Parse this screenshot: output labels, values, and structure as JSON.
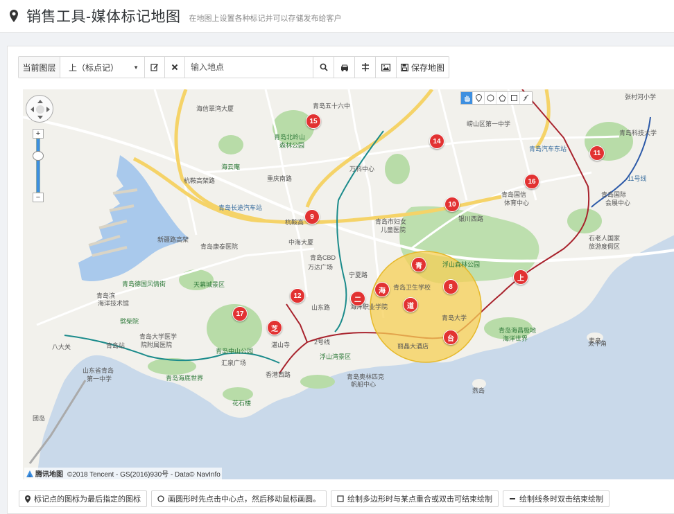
{
  "header": {
    "title": "销售工具-媒体标记地图",
    "subtitle": "在地图上设置各种标记并可以存储发布给客户"
  },
  "toolbar": {
    "layer_label": "当前图层",
    "layer_value": "上（标点记）",
    "location_placeholder": "输入地点",
    "save_label": "保存地图"
  },
  "map": {
    "copyright": "©2018 Tencent - GS(2016)930号 - Data© NavInfo",
    "provider_label": "腾讯地图",
    "markers": [
      {
        "label": "15"
      },
      {
        "label": "14"
      },
      {
        "label": "11"
      },
      {
        "label": "16"
      },
      {
        "label": "10"
      },
      {
        "label": "9"
      },
      {
        "label": "青"
      },
      {
        "label": "海"
      },
      {
        "label": "8"
      },
      {
        "label": "上"
      },
      {
        "label": "二"
      },
      {
        "label": "12"
      },
      {
        "label": "道"
      },
      {
        "label": "17"
      },
      {
        "label": "芝"
      },
      {
        "label": "台"
      }
    ],
    "pois": [
      {
        "name": "海信翠湾大厦"
      },
      {
        "name": "青岛五十六中"
      },
      {
        "name": "青岛北岭山"
      },
      {
        "name": "森林公园"
      },
      {
        "name": "海云庵"
      },
      {
        "name": "万科中心"
      },
      {
        "name": "崂山区第一中学"
      },
      {
        "name": "青岛汽车东站"
      },
      {
        "name": "张村河小学"
      },
      {
        "name": "青岛科技大学"
      },
      {
        "name": "重庆南路"
      },
      {
        "name": "杭鞍高架路"
      },
      {
        "name": "青岛长途汽车站"
      },
      {
        "name": "杭鞍高"
      },
      {
        "name": "青岛市妇女"
      },
      {
        "name": "儿童医院"
      },
      {
        "name": "青岛国信"
      },
      {
        "name": "体育中心"
      },
      {
        "name": "青岛国际"
      },
      {
        "name": "会展中心"
      },
      {
        "name": "银川西路"
      },
      {
        "name": "新疆路高架"
      },
      {
        "name": "青岛康泰医院"
      },
      {
        "name": "中海大厦"
      },
      {
        "name": "青岛CBD"
      },
      {
        "name": "万达广场"
      },
      {
        "name": "石老人国家"
      },
      {
        "name": "旅游度假区"
      },
      {
        "name": "浮山森林公园"
      },
      {
        "name": "宁夏路"
      },
      {
        "name": "青岛德国风情街"
      },
      {
        "name": "天幕城景区"
      },
      {
        "name": "青岛卫生学校"
      },
      {
        "name": "海洋职业学院"
      },
      {
        "name": "青岛滨"
      },
      {
        "name": "海洋技术馆"
      },
      {
        "name": "山东路"
      },
      {
        "name": "青岛大学"
      },
      {
        "name": "劈柴院"
      },
      {
        "name": "青岛大学医学"
      },
      {
        "name": "院附属医院"
      },
      {
        "name": "湛山寺"
      },
      {
        "name": "青岛海昌极地"
      },
      {
        "name": "海洋世界"
      },
      {
        "name": "青岛站"
      },
      {
        "name": "青岛中山公园"
      },
      {
        "name": "汇泉广场"
      },
      {
        "name": "丽晶大酒店"
      },
      {
        "name": "太平角"
      },
      {
        "name": "八大关"
      },
      {
        "name": "山东省青岛"
      },
      {
        "name": "第一中学"
      },
      {
        "name": "青岛海底世界"
      },
      {
        "name": "花石楼"
      },
      {
        "name": "浮山湾景区"
      },
      {
        "name": "青岛奥林匹克"
      },
      {
        "name": "帆船中心"
      },
      {
        "name": "燕岛"
      },
      {
        "name": "麦岛"
      },
      {
        "name": "团岛"
      },
      {
        "name": "香港西路"
      },
      {
        "name": "2号线"
      },
      {
        "name": "11号线"
      }
    ]
  },
  "hints": [
    {
      "text": "标记点的图标为最后指定的图标"
    },
    {
      "text": "画圆形时先点击中心点，然后移动鼠标画圆。"
    },
    {
      "text": "绘制多边形时与某点重合或双击可结束绘制"
    },
    {
      "text": "绘制线条时双击结束绘制"
    }
  ],
  "colors": {
    "marker": "#e23232",
    "circle_fill": "#f5cf55",
    "accent": "#3d8fe0",
    "metro_line": "#a8222c",
    "road_yellow": "#f5d368"
  }
}
